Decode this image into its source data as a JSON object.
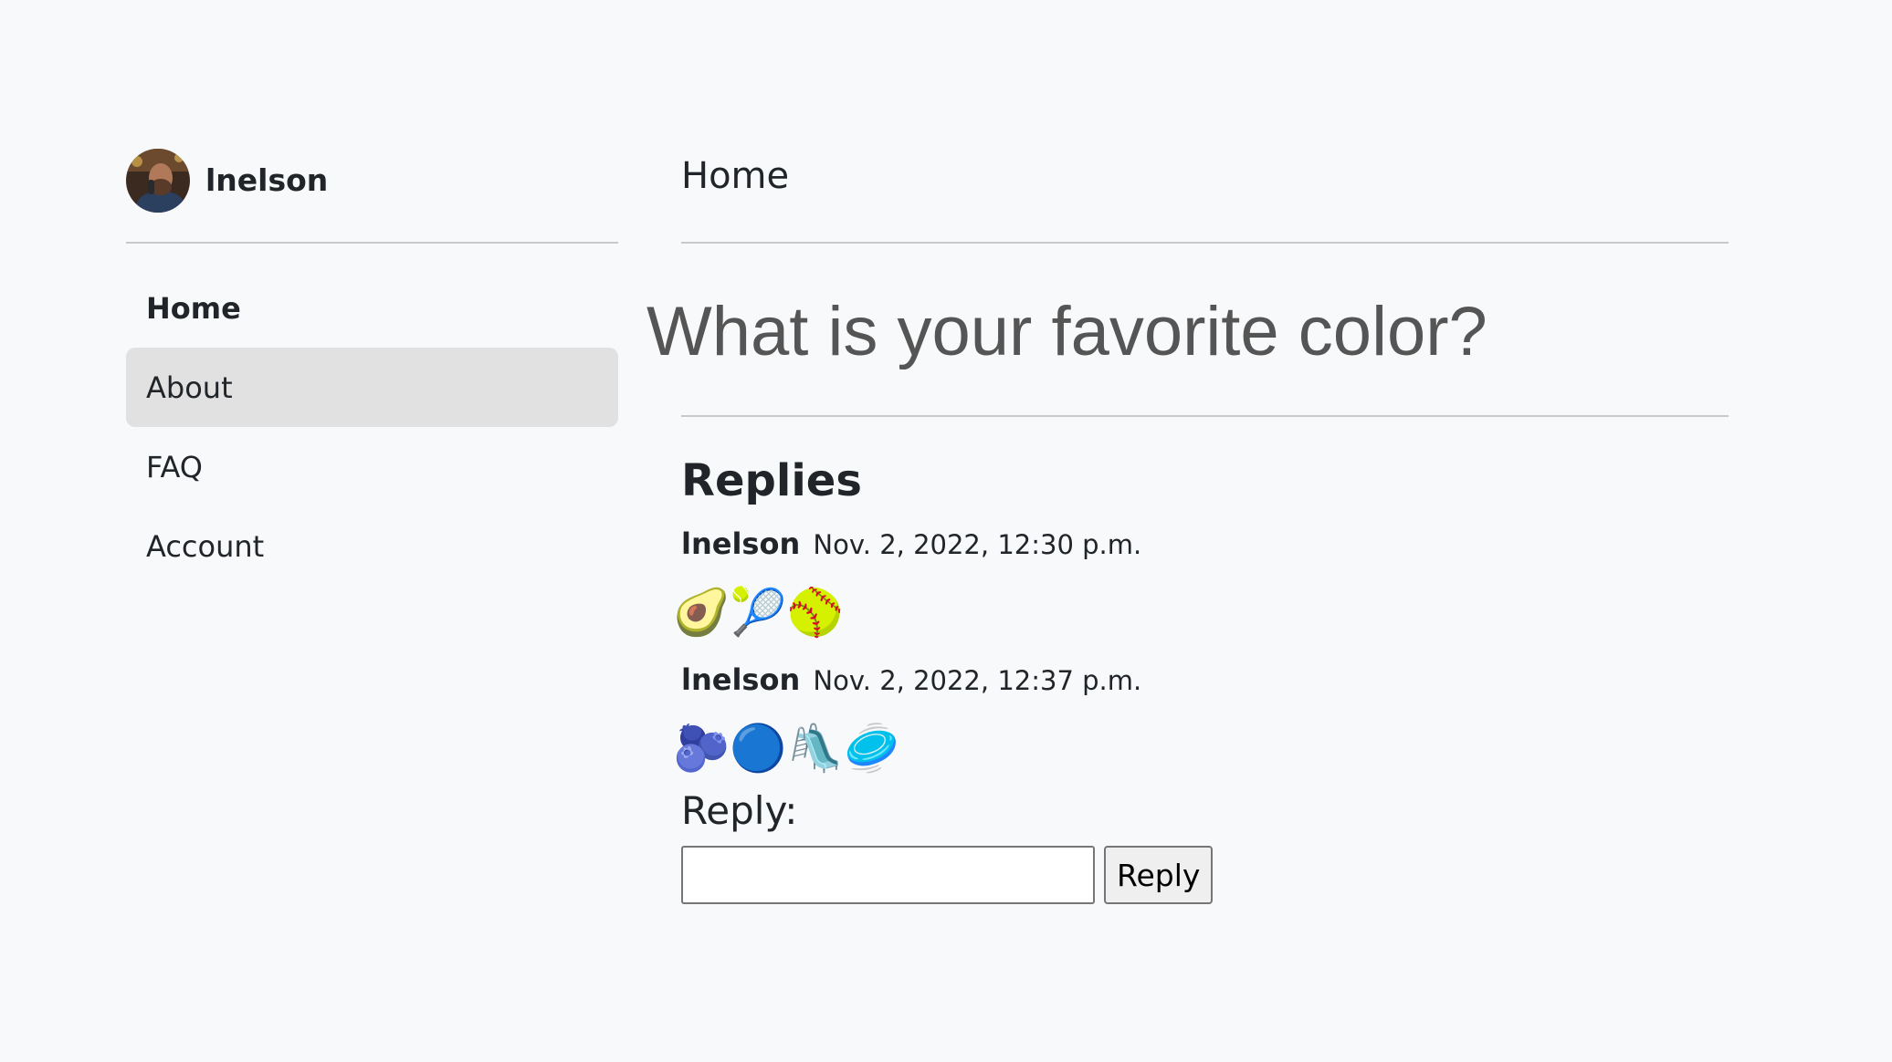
{
  "user": {
    "name": "lnelson",
    "avatar_icon": "user-avatar-photo"
  },
  "sidebar": {
    "items": [
      {
        "label": "Home",
        "active": true
      },
      {
        "label": "About",
        "hovered": true
      },
      {
        "label": "FAQ"
      },
      {
        "label": "Account"
      }
    ]
  },
  "main": {
    "page_title": "Home",
    "question": "What is your favorite color?",
    "replies_heading": "Replies",
    "replies": [
      {
        "author": "lnelson",
        "date": "Nov. 2, 2022, 12:30 p.m.",
        "content": "🥑🎾🥎"
      },
      {
        "author": "lnelson",
        "date": "Nov. 2, 2022, 12:37 p.m.",
        "content": "🫐🔵🛝🥏"
      }
    ],
    "reply_form": {
      "label": "Reply:",
      "input_value": "",
      "button_label": "Reply"
    }
  },
  "colors": {
    "background": "#f8f9fa",
    "nav_hover": "#e1e1e1",
    "question_text": "#555555",
    "divider": "#c7c9cc"
  }
}
